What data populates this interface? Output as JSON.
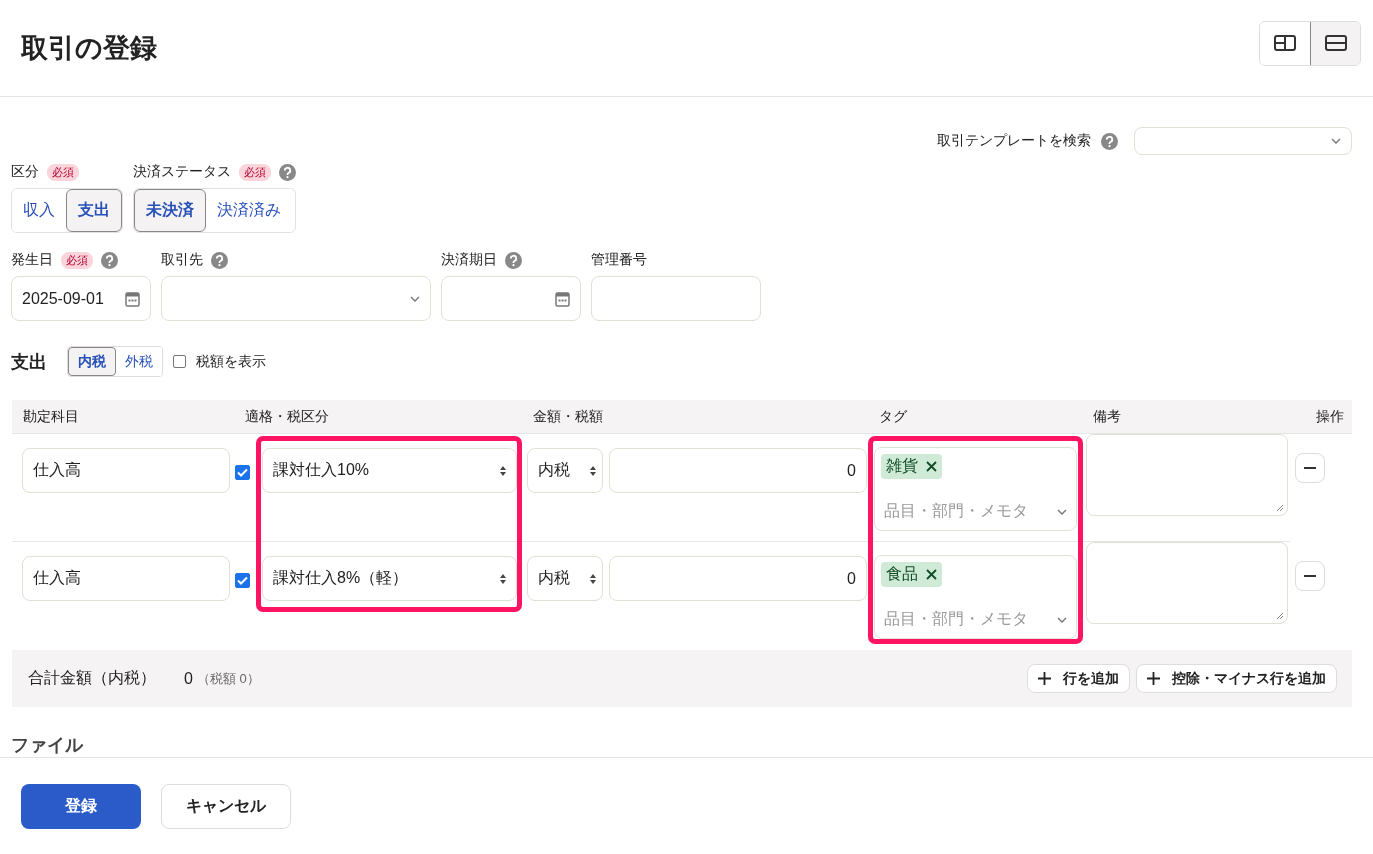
{
  "page": {
    "title": "取引の登録"
  },
  "layout_toggle": [
    {
      "kind": "split",
      "selected": false
    },
    {
      "kind": "stacked",
      "selected": true
    }
  ],
  "template_search": {
    "label": "取引テンプレートを検索"
  },
  "type_field": {
    "label": "区分",
    "required": "必須",
    "options": [
      {
        "label": "収入",
        "selected": false
      },
      {
        "label": "支出",
        "selected": true
      }
    ]
  },
  "status_field": {
    "label": "決済ステータス",
    "required": "必須",
    "options": [
      {
        "label": "未決済",
        "selected": true
      },
      {
        "label": "決済済み",
        "selected": false
      }
    ]
  },
  "fields": [
    {
      "kind": "date",
      "label": "発生日",
      "required": "必須",
      "value": "2025-09-01"
    },
    {
      "kind": "select",
      "label": "取引先"
    },
    {
      "kind": "date",
      "label": "決済期日"
    },
    {
      "kind": "text",
      "label": "管理番号"
    }
  ],
  "expense": {
    "title": "支出",
    "tax_modes": [
      {
        "label": "内税",
        "selected": true
      },
      {
        "label": "外税",
        "selected": false
      }
    ],
    "show_tax": {
      "label": "税額を表示",
      "checked": false
    }
  },
  "table": {
    "columns": [
      {
        "label": "勘定科目",
        "highlighted": false
      },
      {
        "label": "適格・税区分",
        "highlighted": true
      },
      {
        "label": "金額・税額",
        "highlighted": false
      },
      {
        "label": "タグ",
        "highlighted": true
      },
      {
        "label": "備考",
        "highlighted": false
      },
      {
        "label": "操作",
        "highlighted": false
      }
    ],
    "rows": [
      {
        "account": "仕入高",
        "qualified": true,
        "tax_category": "課対仕入10%",
        "tax_mode": "内税",
        "amount": "0",
        "tags": [
          {
            "label": "雑貨"
          }
        ],
        "tag_placeholder": "品目・部門・メモタ"
      },
      {
        "account": "仕入高",
        "qualified": true,
        "tax_category": "課対仕入8%（軽）",
        "tax_mode": "内税",
        "amount": "0",
        "tags": [
          {
            "label": "食品"
          }
        ],
        "tag_placeholder": "品目・部門・メモタ"
      }
    ]
  },
  "totals": {
    "label": "合計金額（内税）",
    "amount": "0",
    "tax_note": "（税額 0）",
    "actions": [
      "行を追加",
      "控除・マイナス行を追加"
    ]
  },
  "file_section": {
    "title": "ファイル"
  },
  "footer_buttons": [
    {
      "kind": "primary",
      "label": "登録"
    },
    {
      "kind": "secondary",
      "label": "キャンセル"
    }
  ]
}
